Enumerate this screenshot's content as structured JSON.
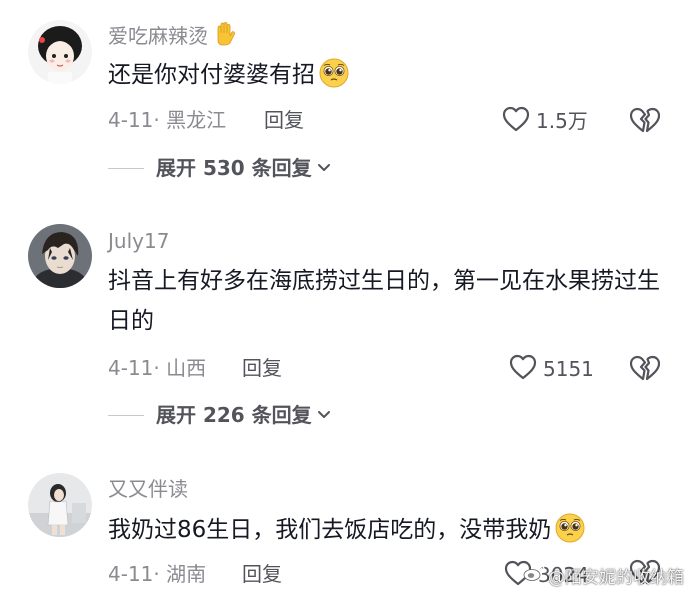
{
  "comments": [
    {
      "username": "爱吃麻辣烫",
      "username_icon": "raised-hand-emoji",
      "text": "还是你对付婆婆有招",
      "text_icon": "pleading-face-emoji",
      "date": "4-11",
      "location": "黑龙江",
      "reply_label": "回复",
      "likes": "1.5万",
      "expand_label": "展开 530 条回复"
    },
    {
      "username": "July17",
      "text": "抖音上有好多在海底捞过生日的，第一见在水果捞过生日的",
      "date": "4-11",
      "location": "山西",
      "reply_label": "回复",
      "likes": "5151",
      "expand_label": "展开 226 条回复"
    },
    {
      "username": "又又伴读",
      "text": "我奶过86生日，我们去饭店吃的，没带我奶",
      "text_icon": "pleading-face-emoji",
      "date": "4-11",
      "location": "湖南",
      "reply_label": "回复",
      "likes": "3024"
    }
  ],
  "watermark": "@陌安妮的收纳箱",
  "colors": {
    "text": "#161823",
    "secondary": "#8a8b91",
    "action": "#53545b",
    "divider": "#c8c9cc"
  }
}
